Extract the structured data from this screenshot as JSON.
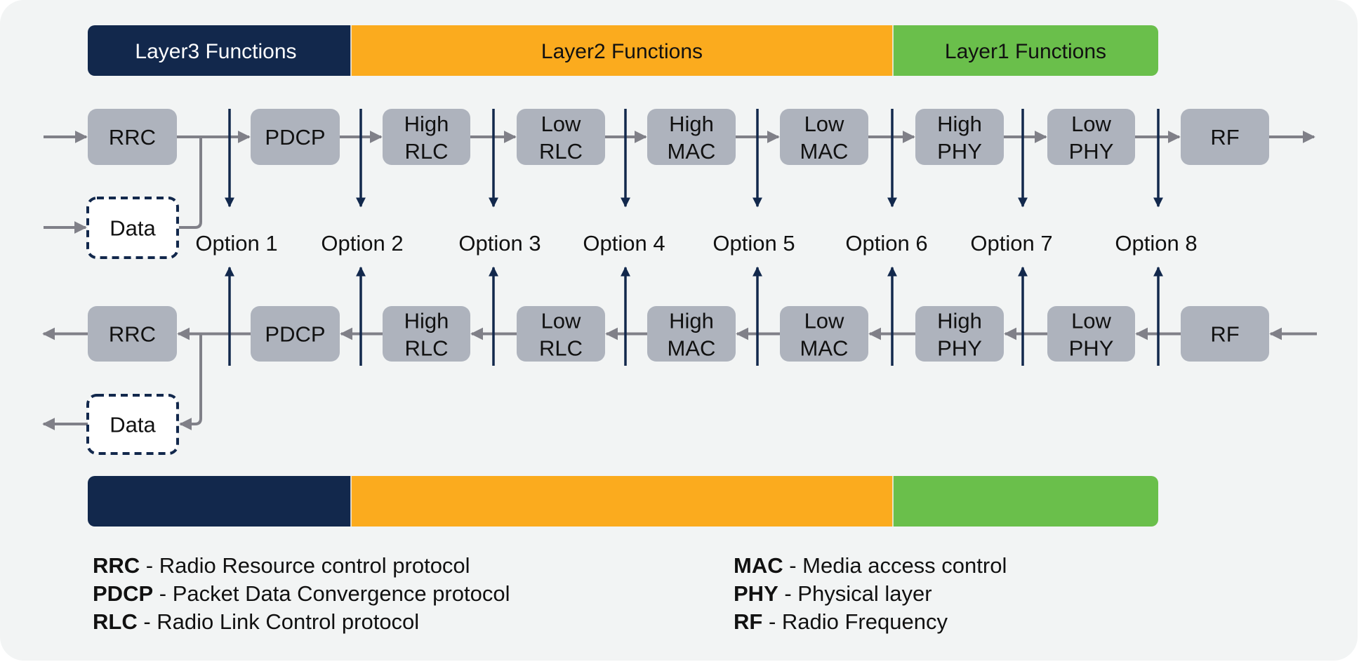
{
  "colors": {
    "layer3": "#12284c",
    "layer2": "#fbab1e",
    "layer1": "#6abf4b",
    "box": "#aeb3bd",
    "flow_arrow": "#808088",
    "split_arrow": "#12284c",
    "background": "#f2f4f4"
  },
  "top_bar": [
    {
      "label": "Layer3 Functions",
      "color": "#12284c",
      "text_color": "#ffffff"
    },
    {
      "label": "Layer2 Functions",
      "color": "#fbab1e",
      "text_color": "#111111"
    },
    {
      "label": "Layer1 Functions",
      "color": "#6abf4b",
      "text_color": "#111111"
    }
  ],
  "blocks": [
    {
      "lines": [
        "RRC"
      ]
    },
    {
      "lines": [
        "PDCP"
      ]
    },
    {
      "lines": [
        "High",
        "RLC"
      ]
    },
    {
      "lines": [
        "Low",
        "RLC"
      ]
    },
    {
      "lines": [
        "High",
        "MAC"
      ]
    },
    {
      "lines": [
        "Low",
        "MAC"
      ]
    },
    {
      "lines": [
        "High",
        "PHY"
      ]
    },
    {
      "lines": [
        "Low",
        "PHY"
      ]
    },
    {
      "lines": [
        "RF"
      ]
    }
  ],
  "data_block": {
    "label": "Data"
  },
  "options": [
    "Option 1",
    "Option 2",
    "Option 3",
    "Option 4",
    "Option 5",
    "Option 6",
    "Option 7",
    "Option 8"
  ],
  "legend": {
    "left": [
      {
        "abbr": "RRC",
        "desc": " - Radio Resource control protocol"
      },
      {
        "abbr": "PDCP",
        "desc": " - Packet Data Convergence protocol"
      },
      {
        "abbr": "RLC",
        "desc": " - Radio Link Control protocol"
      }
    ],
    "right": [
      {
        "abbr": "MAC",
        "desc": " - Media access control"
      },
      {
        "abbr": "PHY",
        "desc": " - Physical layer"
      },
      {
        "abbr": "RF",
        "desc": " - Radio Frequency"
      }
    ]
  }
}
